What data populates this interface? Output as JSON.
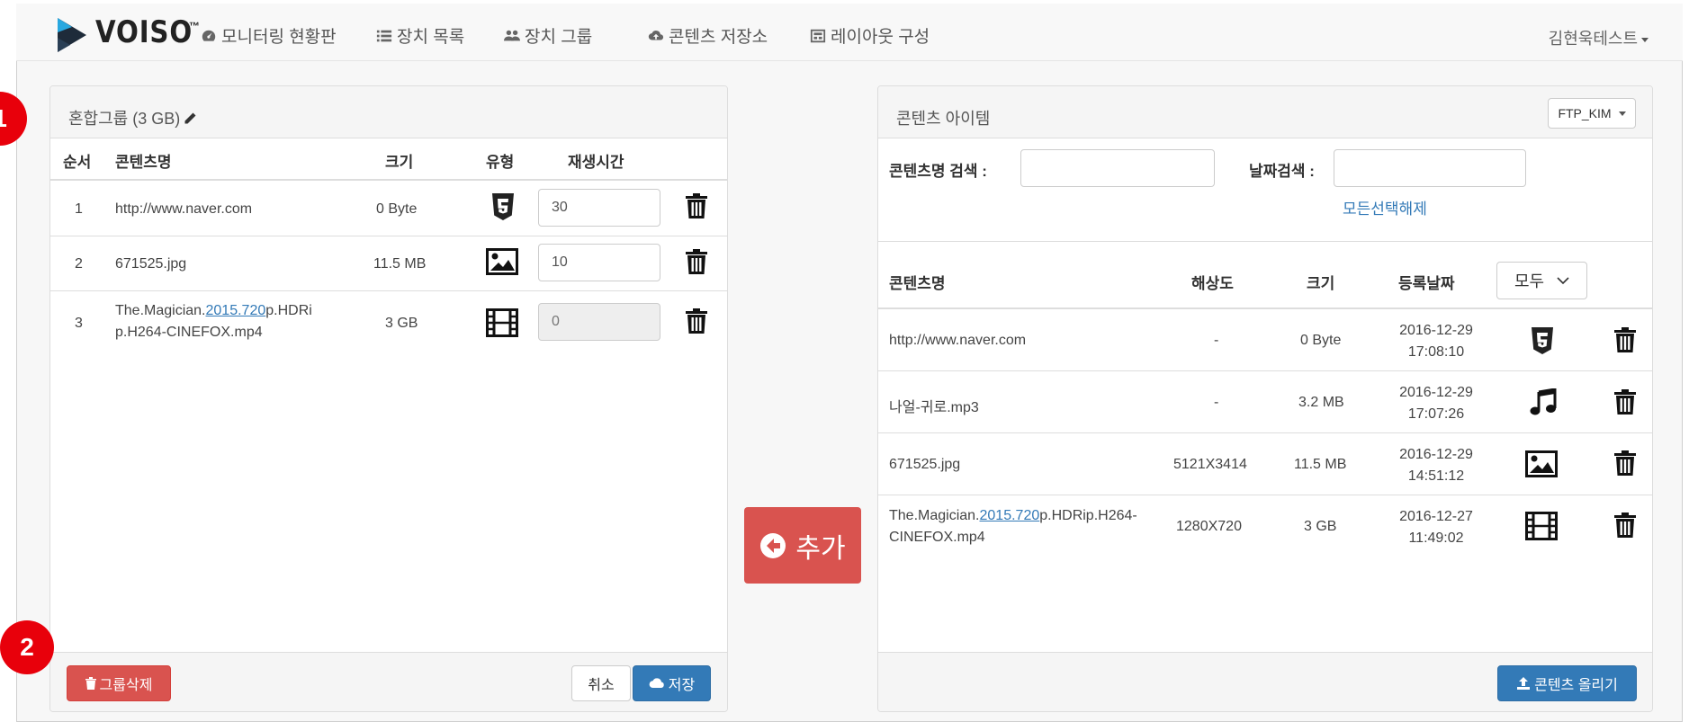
{
  "app": {
    "logo_text": "VOISO",
    "logo_tm": "™",
    "nav": [
      {
        "label": "모니터링 현황판",
        "icon": "dashboard-icon"
      },
      {
        "label": "장치 목록",
        "icon": "list-icon"
      },
      {
        "label": "장치 그룹",
        "icon": "users-icon"
      },
      {
        "label": "콘텐츠 저장소",
        "icon": "cloud-upload-icon"
      },
      {
        "label": "레이아웃 구성",
        "icon": "layout-icon"
      }
    ],
    "user": "김현욱테스트"
  },
  "group_panel": {
    "title": "혼합그룹 (3 GB)",
    "columns": {
      "order": "순서",
      "name": "콘텐츠명",
      "size": "크기",
      "type": "유형",
      "duration": "재생시간"
    },
    "rows": [
      {
        "order": "1",
        "name": "http://www.naver.com",
        "size": "0 Byte",
        "type_icon": "html5-icon",
        "duration": "30",
        "disabled": false
      },
      {
        "order": "2",
        "name": "671525.jpg",
        "size": "11.5 MB",
        "type_icon": "image-icon",
        "duration": "10",
        "disabled": false
      },
      {
        "order": "3",
        "name_pre": "The.Magician.",
        "name_link": "2015.720",
        "name_post_1": "p.HDRi",
        "name_post_2": "p.H264-CINEFOX.mp4",
        "size": "3 GB",
        "type_icon": "film-icon",
        "duration": "0",
        "disabled": true
      }
    ],
    "delete_group_label": "그룹삭제",
    "cancel_label": "취소",
    "save_label": "저장"
  },
  "add_button_label": "추가",
  "content_panel": {
    "title": "콘텐츠 아이템",
    "storage_dropdown": "FTP_KIM",
    "search_name_label": "콘텐츠명 검색 :",
    "search_name_value": "",
    "search_date_label": "날짜검색 :",
    "search_date_value": "",
    "clear_selection_label": "모든선택해제",
    "columns": {
      "name": "콘텐츠명",
      "resolution": "해상도",
      "size": "크기",
      "date": "등록날짜"
    },
    "type_filter": "모두",
    "rows": [
      {
        "name": "http://www.naver.com",
        "resolution": "-",
        "size": "0 Byte",
        "date": "2016-12-29",
        "time": "17:08:10",
        "type_icon": "html5-icon"
      },
      {
        "name": "나얼-귀로.mp3",
        "resolution": "-",
        "size": "3.2 MB",
        "date": "2016-12-29",
        "time": "17:07:26",
        "type_icon": "music-icon"
      },
      {
        "name": "671525.jpg",
        "resolution": "5121X3414",
        "size": "11.5 MB",
        "date": "2016-12-29",
        "time": "14:51:12",
        "type_icon": "image-icon"
      },
      {
        "name_pre": "The.Magician.",
        "name_link": "2015.720",
        "name_post_1": "p.HDRip.H264-",
        "name_post_2": "CINEFOX.mp4",
        "resolution": "1280X720",
        "size": "3 GB",
        "date": "2016-12-27",
        "time": "11:49:02",
        "type_icon": "film-icon"
      }
    ],
    "upload_label": "콘텐츠 올리기"
  },
  "callouts": [
    "1",
    "2"
  ],
  "colors": {
    "danger": "#d9534f",
    "primary": "#337ab7",
    "callout": "#e8000b"
  }
}
